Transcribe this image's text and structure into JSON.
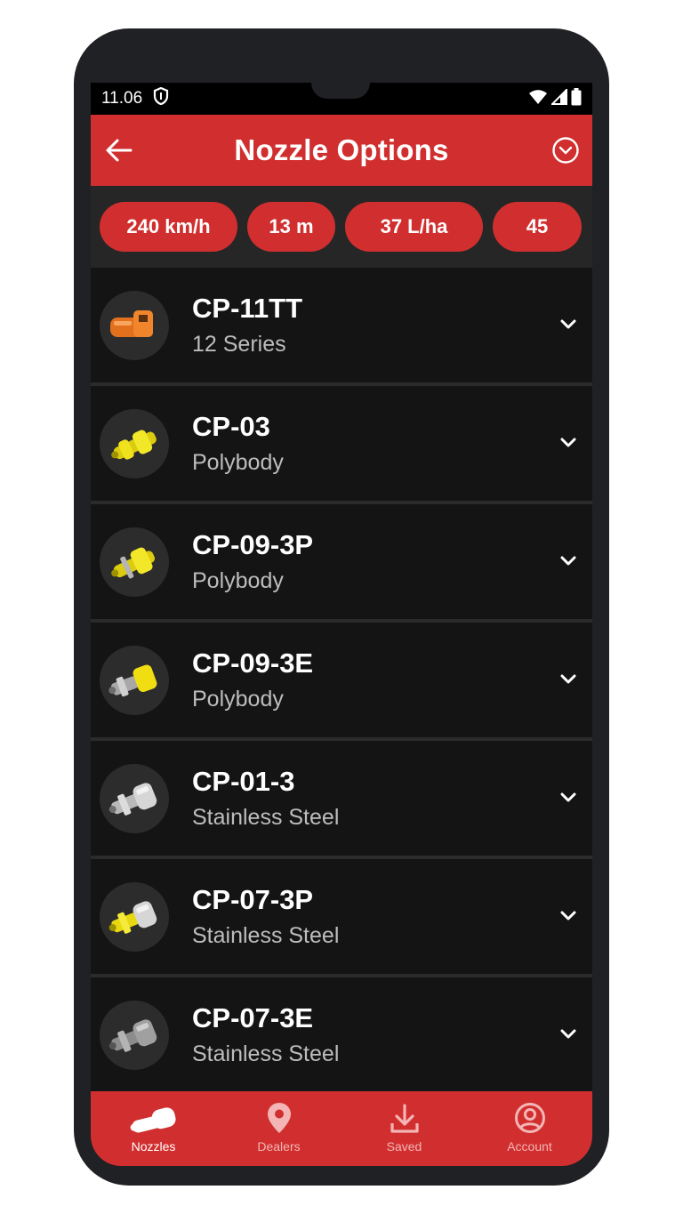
{
  "status_bar": {
    "time": "11.06",
    "icons": [
      "shield-icon",
      "wifi-icon",
      "signal-icon",
      "battery-icon"
    ]
  },
  "app_bar": {
    "title": "Nozzle Options",
    "back_icon": "arrow-left-icon",
    "options_icon": "chevron-circle-down-icon"
  },
  "chips": [
    {
      "label": "240 km/h"
    },
    {
      "label": "13 m"
    },
    {
      "label": "37 L/ha"
    },
    {
      "label": "45"
    }
  ],
  "nozzles": [
    {
      "name": "CP-11TT",
      "series": "12 Series",
      "image": "orange-nozzle"
    },
    {
      "name": "CP-03",
      "series": "Polybody",
      "image": "yellow-nozzle"
    },
    {
      "name": "CP-09-3P",
      "series": "Polybody",
      "image": "yellow-nozzle"
    },
    {
      "name": "CP-09-3E",
      "series": "Polybody",
      "image": "yellow-steel-nozzle"
    },
    {
      "name": "CP-01-3",
      "series": "Stainless Steel",
      "image": "steel-nozzle"
    },
    {
      "name": "CP-07-3P",
      "series": "Stainless Steel",
      "image": "yellow-steel-nozzle"
    },
    {
      "name": "CP-07-3E",
      "series": "Stainless Steel",
      "image": "steel-nozzle"
    }
  ],
  "bottom_nav": [
    {
      "label": "Nozzles",
      "icon": "nozzle-icon",
      "active": true
    },
    {
      "label": "Dealers",
      "icon": "location-pin-icon",
      "active": false
    },
    {
      "label": "Saved",
      "icon": "download-icon",
      "active": false
    },
    {
      "label": "Account",
      "icon": "account-circle-icon",
      "active": false
    }
  ],
  "colors": {
    "accent": "#d12f2f",
    "background": "#141414",
    "chip_bar": "#262626"
  }
}
